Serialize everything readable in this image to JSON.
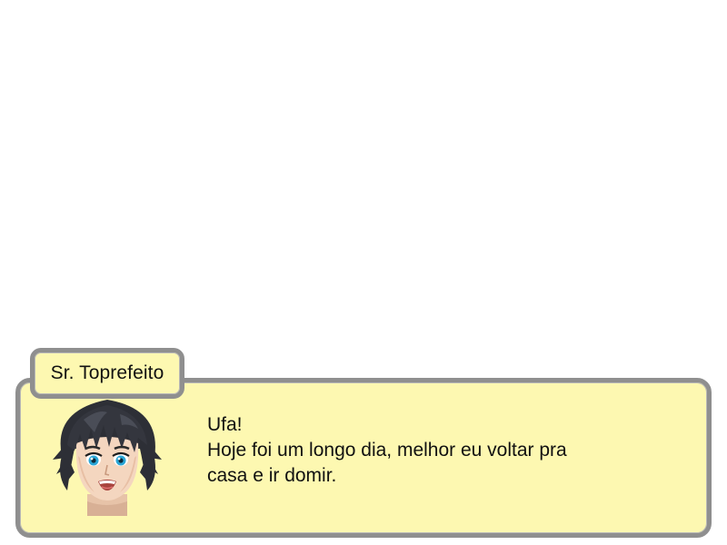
{
  "speaker": {
    "name": "Sr. Toprefeito",
    "portrait_icon": "young-man-black-hair-blue-eyes-portrait"
  },
  "dialogue": {
    "lines": [
      "Ufa!",
      "Hoje foi um longo dia, melhor eu voltar pra",
      "casa e ir domir."
    ]
  },
  "colors": {
    "box_fill": "#fdf8b1",
    "box_border": "#8f8f8f",
    "text": "#111111",
    "background": "#ffffff"
  }
}
